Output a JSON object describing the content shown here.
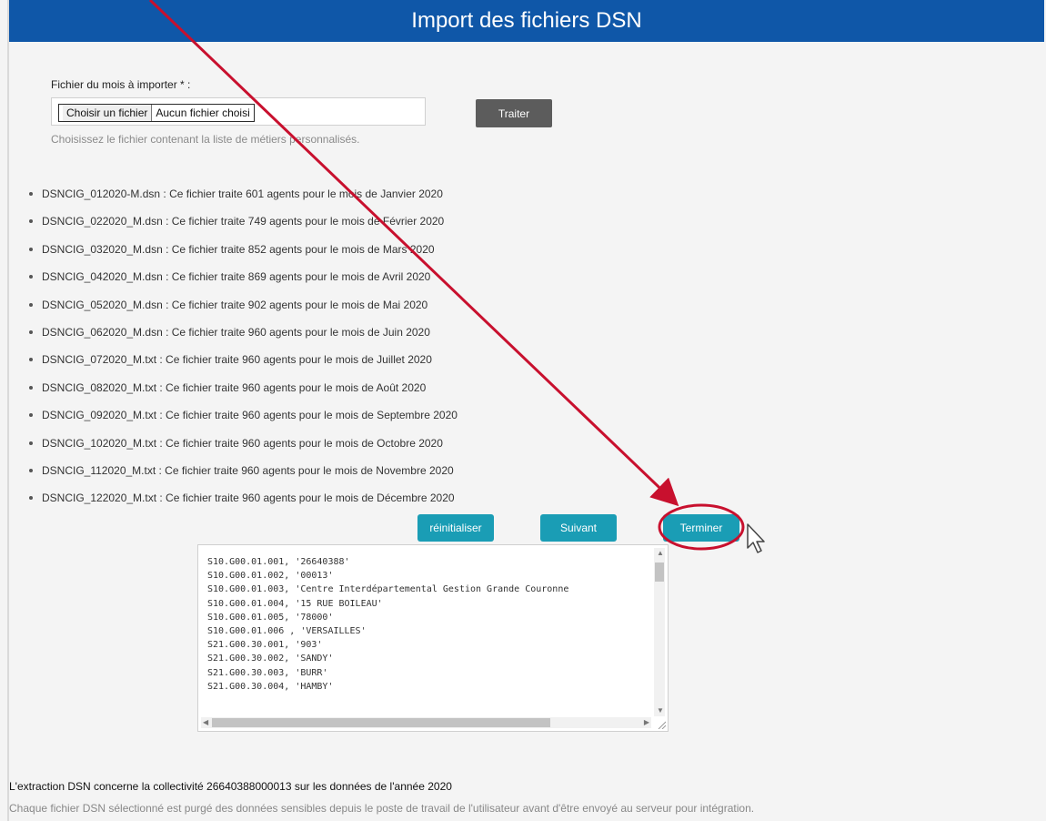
{
  "header": {
    "title": "Import des fichiers DSN"
  },
  "upload": {
    "label": "Fichier du mois à importer * :",
    "choose_button": "Choisir un fichier",
    "no_file_text": "Aucun fichier choisi",
    "submit_label": "Traiter",
    "hint": "Choisissez le fichier contenant la liste de métiers personnalisés."
  },
  "files": [
    "DSNCIG_012020-M.dsn : Ce fichier traite 601 agents pour le mois de Janvier 2020",
    "DSNCIG_022020_M.dsn : Ce fichier traite 749 agents pour le mois de Février 2020",
    "DSNCIG_032020_M.dsn : Ce fichier traite 852 agents pour le mois de Mars 2020",
    "DSNCIG_042020_M.dsn : Ce fichier traite 869 agents pour le mois de Avril 2020",
    "DSNCIG_052020_M.dsn : Ce fichier traite 902 agents pour le mois de Mai 2020",
    "DSNCIG_062020_M.dsn : Ce fichier traite 960 agents pour le mois de Juin 2020",
    "DSNCIG_072020_M.txt : Ce fichier traite 960 agents pour le mois de Juillet 2020",
    "DSNCIG_082020_M.txt : Ce fichier traite 960 agents pour le mois de Août 2020",
    "DSNCIG_092020_M.txt : Ce fichier traite 960 agents pour le mois de Septembre 2020",
    "DSNCIG_102020_M.txt : Ce fichier traite 960 agents pour le mois de Octobre 2020",
    "DSNCIG_112020_M.txt : Ce fichier traite 960 agents pour le mois de Novembre 2020",
    "DSNCIG_122020_M.txt : Ce fichier traite 960 agents pour le mois de Décembre 2020"
  ],
  "actions": {
    "reset": "réinitialiser",
    "next": "Suivant",
    "finish": "Terminer"
  },
  "code_lines": [
    "S10.G00.01.001, '26640388'",
    "S10.G00.01.002, '00013'",
    "S10.G00.01.003, 'Centre Interdépartemental Gestion Grande Couronne",
    "S10.G00.01.004, '15 RUE BOILEAU'",
    "S10.G00.01.005, '78000'",
    "S10.G00.01.006 , 'VERSAILLES'",
    "S21.G00.30.001, '903'",
    "S21.G00.30.002, 'SANDY'",
    "S21.G00.30.003, 'BURR'",
    "S21.G00.30.004, 'HAMBY'"
  ],
  "footer": {
    "title": "L'extraction DSN concerne la collectivité 26640388000013 sur les données de l'année 2020",
    "note": "Chaque fichier DSN sélectionné est purgé des données sensibles depuis le poste de travail de l'utilisateur avant d'être envoyé au serveur pour intégration."
  },
  "colors": {
    "header_bg": "#0f57a8",
    "action_btn": "#1a9db5",
    "submit_btn": "#5c5c5c",
    "annotation": "#c8102e"
  }
}
